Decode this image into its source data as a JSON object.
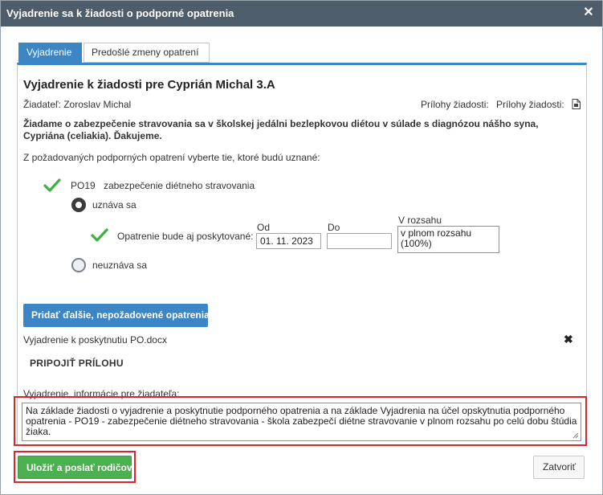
{
  "dialog": {
    "title": "Vyjadrenie sa k žiadosti o podporné opatrenia",
    "close_icon": "close-icon"
  },
  "tabs": [
    {
      "label": "Vyjadrenie",
      "active": true
    },
    {
      "label": "Predošlé zmeny opatrení",
      "active": false
    }
  ],
  "content": {
    "heading": "Vyjadrenie k žiadosti pre Cyprián Michal 3.A",
    "applicant": "Žiadateľ: Zoroslav Michal",
    "attachments_label_1": "Prílohy žiadosti:",
    "attachments_label_2": "Prílohy žiadosti:",
    "attachment_icon": "document-icon",
    "request_text_line1": "Žiadame o zabezpečenie stravovania sa v školskej jedálni bezlepkovou diétou v súlade s diagnózou nášho syna,",
    "request_text_line2": "Cypriána (celiakia). Ďakujeme.",
    "instruction": "Z požadovaných podporných opatrení vyberte tie, ktoré budú uznané:",
    "measure": {
      "code": "PO19",
      "name": "zabezpečenie diétneho stravovania",
      "option_accepted": "uznáva sa",
      "option_rejected": "neuznáva sa",
      "selected": "uznáva sa",
      "provided_label": "Opatrenie bude aj poskytované:",
      "from_label": "Od",
      "from_value": "01. 11. 2023",
      "to_label": "Do",
      "to_value": "",
      "scope_label": "V rozsahu",
      "scope_value": "v plnom rozsahu (100%)"
    },
    "add_button": "Pridať ďalšie, nepožadovené opatrenia",
    "attached_file": "Vyjadrenie k poskytnutiu PO.docx",
    "attach_button": "PRIPOJIŤ PRÍLOHU",
    "statement_label": "Vyjadrenie, informácie pre žiadateľa:",
    "statement_value": "Na základe žiadosti o vyjadrenie a poskytnutie podporného opatrenia a na základe Vyjadrenia na účel opskytnutia podporného opatrenia - PO19 - zabezpečenie diétneho stravovania - škola zabezpečí diétne stravovanie v plnom rozsahu po celú dobu štúdia žiaka."
  },
  "footer": {
    "save_button": "Uložiť a poslať rodičovi",
    "close_button": "Zatvoriť"
  },
  "colors": {
    "titlebar": "#4e5d6c",
    "accent": "#3c86c6",
    "success": "#4caf50",
    "check": "#3cb043",
    "highlight": "#d9262c"
  }
}
